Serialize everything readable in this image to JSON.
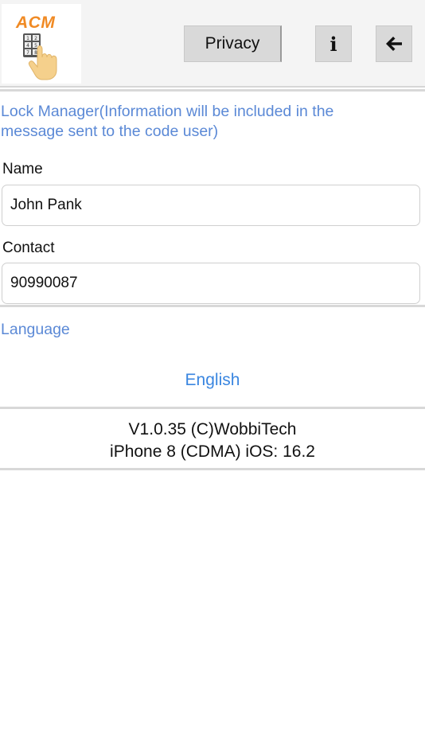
{
  "header": {
    "logo_text": "ACM",
    "keypad_keys": [
      "1",
      "2",
      "4",
      "5",
      "7",
      "8"
    ],
    "privacy_label": "Privacy",
    "info_label": "i"
  },
  "lock_manager": {
    "title": "Lock Manager(Information will be included in the message sent to the code user)",
    "name_label": "Name",
    "name_value": "John Pank",
    "contact_label": "Contact",
    "contact_value": "90990087"
  },
  "language": {
    "title": "Language",
    "selected": "English"
  },
  "footer": {
    "version_line": "V1.0.35 (C)WobbiTech",
    "device_line": "iPhone 8 (CDMA) iOS: 16.2"
  },
  "colors": {
    "accent_blue": "#3a86e0",
    "section_blue": "#5b89d6",
    "logo_orange": "#f08a24"
  }
}
